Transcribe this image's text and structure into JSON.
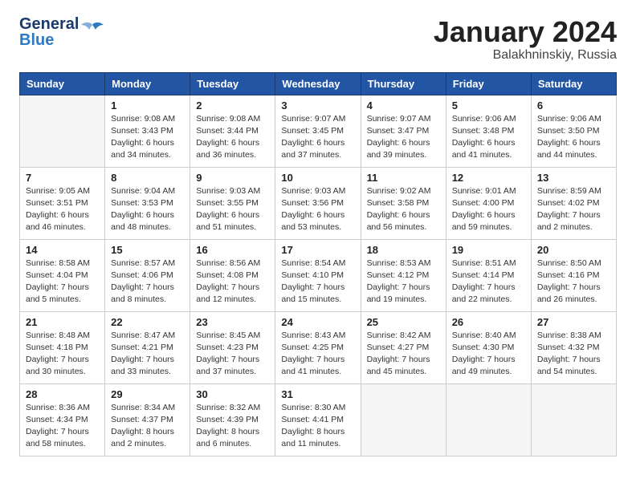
{
  "header": {
    "logo_general": "General",
    "logo_blue": "Blue",
    "title": "January 2024",
    "location": "Balakhninskiy, Russia"
  },
  "days_of_week": [
    "Sunday",
    "Monday",
    "Tuesday",
    "Wednesday",
    "Thursday",
    "Friday",
    "Saturday"
  ],
  "weeks": [
    [
      {
        "day": "",
        "info": ""
      },
      {
        "day": "1",
        "info": "Sunrise: 9:08 AM\nSunset: 3:43 PM\nDaylight: 6 hours\nand 34 minutes."
      },
      {
        "day": "2",
        "info": "Sunrise: 9:08 AM\nSunset: 3:44 PM\nDaylight: 6 hours\nand 36 minutes."
      },
      {
        "day": "3",
        "info": "Sunrise: 9:07 AM\nSunset: 3:45 PM\nDaylight: 6 hours\nand 37 minutes."
      },
      {
        "day": "4",
        "info": "Sunrise: 9:07 AM\nSunset: 3:47 PM\nDaylight: 6 hours\nand 39 minutes."
      },
      {
        "day": "5",
        "info": "Sunrise: 9:06 AM\nSunset: 3:48 PM\nDaylight: 6 hours\nand 41 minutes."
      },
      {
        "day": "6",
        "info": "Sunrise: 9:06 AM\nSunset: 3:50 PM\nDaylight: 6 hours\nand 44 minutes."
      }
    ],
    [
      {
        "day": "7",
        "info": "Sunrise: 9:05 AM\nSunset: 3:51 PM\nDaylight: 6 hours\nand 46 minutes."
      },
      {
        "day": "8",
        "info": "Sunrise: 9:04 AM\nSunset: 3:53 PM\nDaylight: 6 hours\nand 48 minutes."
      },
      {
        "day": "9",
        "info": "Sunrise: 9:03 AM\nSunset: 3:55 PM\nDaylight: 6 hours\nand 51 minutes."
      },
      {
        "day": "10",
        "info": "Sunrise: 9:03 AM\nSunset: 3:56 PM\nDaylight: 6 hours\nand 53 minutes."
      },
      {
        "day": "11",
        "info": "Sunrise: 9:02 AM\nSunset: 3:58 PM\nDaylight: 6 hours\nand 56 minutes."
      },
      {
        "day": "12",
        "info": "Sunrise: 9:01 AM\nSunset: 4:00 PM\nDaylight: 6 hours\nand 59 minutes."
      },
      {
        "day": "13",
        "info": "Sunrise: 8:59 AM\nSunset: 4:02 PM\nDaylight: 7 hours\nand 2 minutes."
      }
    ],
    [
      {
        "day": "14",
        "info": "Sunrise: 8:58 AM\nSunset: 4:04 PM\nDaylight: 7 hours\nand 5 minutes."
      },
      {
        "day": "15",
        "info": "Sunrise: 8:57 AM\nSunset: 4:06 PM\nDaylight: 7 hours\nand 8 minutes."
      },
      {
        "day": "16",
        "info": "Sunrise: 8:56 AM\nSunset: 4:08 PM\nDaylight: 7 hours\nand 12 minutes."
      },
      {
        "day": "17",
        "info": "Sunrise: 8:54 AM\nSunset: 4:10 PM\nDaylight: 7 hours\nand 15 minutes."
      },
      {
        "day": "18",
        "info": "Sunrise: 8:53 AM\nSunset: 4:12 PM\nDaylight: 7 hours\nand 19 minutes."
      },
      {
        "day": "19",
        "info": "Sunrise: 8:51 AM\nSunset: 4:14 PM\nDaylight: 7 hours\nand 22 minutes."
      },
      {
        "day": "20",
        "info": "Sunrise: 8:50 AM\nSunset: 4:16 PM\nDaylight: 7 hours\nand 26 minutes."
      }
    ],
    [
      {
        "day": "21",
        "info": "Sunrise: 8:48 AM\nSunset: 4:18 PM\nDaylight: 7 hours\nand 30 minutes."
      },
      {
        "day": "22",
        "info": "Sunrise: 8:47 AM\nSunset: 4:21 PM\nDaylight: 7 hours\nand 33 minutes."
      },
      {
        "day": "23",
        "info": "Sunrise: 8:45 AM\nSunset: 4:23 PM\nDaylight: 7 hours\nand 37 minutes."
      },
      {
        "day": "24",
        "info": "Sunrise: 8:43 AM\nSunset: 4:25 PM\nDaylight: 7 hours\nand 41 minutes."
      },
      {
        "day": "25",
        "info": "Sunrise: 8:42 AM\nSunset: 4:27 PM\nDaylight: 7 hours\nand 45 minutes."
      },
      {
        "day": "26",
        "info": "Sunrise: 8:40 AM\nSunset: 4:30 PM\nDaylight: 7 hours\nand 49 minutes."
      },
      {
        "day": "27",
        "info": "Sunrise: 8:38 AM\nSunset: 4:32 PM\nDaylight: 7 hours\nand 54 minutes."
      }
    ],
    [
      {
        "day": "28",
        "info": "Sunrise: 8:36 AM\nSunset: 4:34 PM\nDaylight: 7 hours\nand 58 minutes."
      },
      {
        "day": "29",
        "info": "Sunrise: 8:34 AM\nSunset: 4:37 PM\nDaylight: 8 hours\nand 2 minutes."
      },
      {
        "day": "30",
        "info": "Sunrise: 8:32 AM\nSunset: 4:39 PM\nDaylight: 8 hours\nand 6 minutes."
      },
      {
        "day": "31",
        "info": "Sunrise: 8:30 AM\nSunset: 4:41 PM\nDaylight: 8 hours\nand 11 minutes."
      },
      {
        "day": "",
        "info": ""
      },
      {
        "day": "",
        "info": ""
      },
      {
        "day": "",
        "info": ""
      }
    ]
  ]
}
